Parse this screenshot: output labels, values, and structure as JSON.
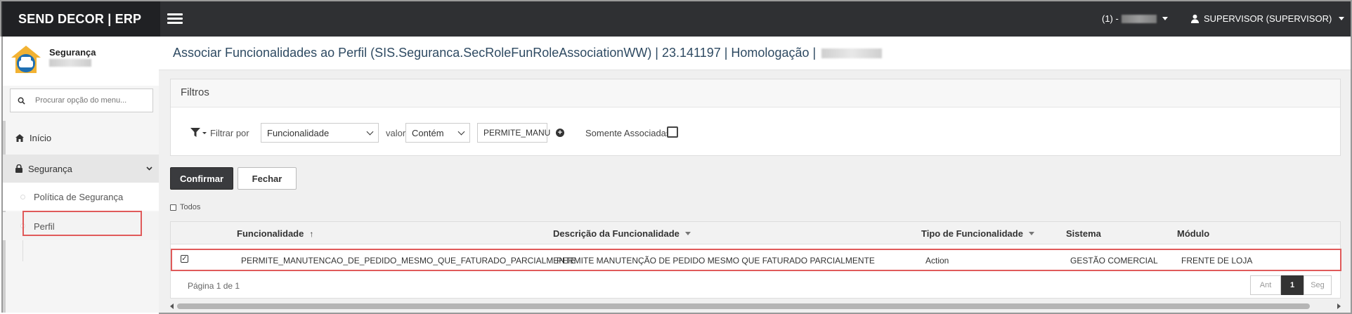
{
  "topbar": {
    "brand": "SEND DECOR | ERP",
    "company_prefix": "(1) -",
    "user_label": "SUPERVISOR (SUPERVISOR)",
    "bg_color": "#2f3033"
  },
  "sidebar": {
    "module_title": "Segurança",
    "search_placeholder": "Procurar opção do menu...",
    "items": [
      {
        "label": "Início",
        "icon": "home-icon"
      },
      {
        "label": "Segurança",
        "icon": "lock-icon",
        "expanded": true
      }
    ],
    "sub_items": [
      {
        "label": "Política de Segurança"
      },
      {
        "label": "Perfil",
        "selected": true
      }
    ]
  },
  "page": {
    "title": "Associar Funcionalidades ao Perfil (SIS.Seguranca.SecRoleFunRoleAssociationWW) | 23.141197 | Homologação |"
  },
  "filters": {
    "heading": "Filtros",
    "filter_by_label": "Filtrar por",
    "filter_field": "Funcionalidade",
    "value_label": "valor",
    "operator": "Contém",
    "value": "PERMITE_MANU",
    "only_associated_label": "Somente Associadas",
    "only_associated_checked": false
  },
  "actions": {
    "confirm_label": "Confirmar",
    "close_label": "Fechar"
  },
  "grid": {
    "select_all_label": "Todos",
    "columns": [
      "Funcionalidade",
      "Descrição da Funcionalidade",
      "Tipo de Funcionalidade",
      "Sistema",
      "Módulo"
    ],
    "rows": [
      {
        "checked": true,
        "funcionalidade": "PERMITE_MANUTENCAO_DE_PEDIDO_MESMO_QUE_FATURADO_PARCIALMENTE",
        "descricao": "PERMITE MANUTENÇÃO DE PEDIDO MESMO QUE FATURADO PARCIALMENTE",
        "tipo": "Action",
        "sistema": "GESTÃO COMERCIAL",
        "modulo": "FRENTE DE LOJA"
      }
    ],
    "pagination": {
      "text": "Página 1 de 1",
      "prev_label": "Ant",
      "current_page": "1",
      "next_label": "Seg"
    }
  },
  "colors": {
    "highlight": "#e05a5a",
    "title_color": "#2e4a62",
    "dark_button": "#3a3b3e"
  }
}
